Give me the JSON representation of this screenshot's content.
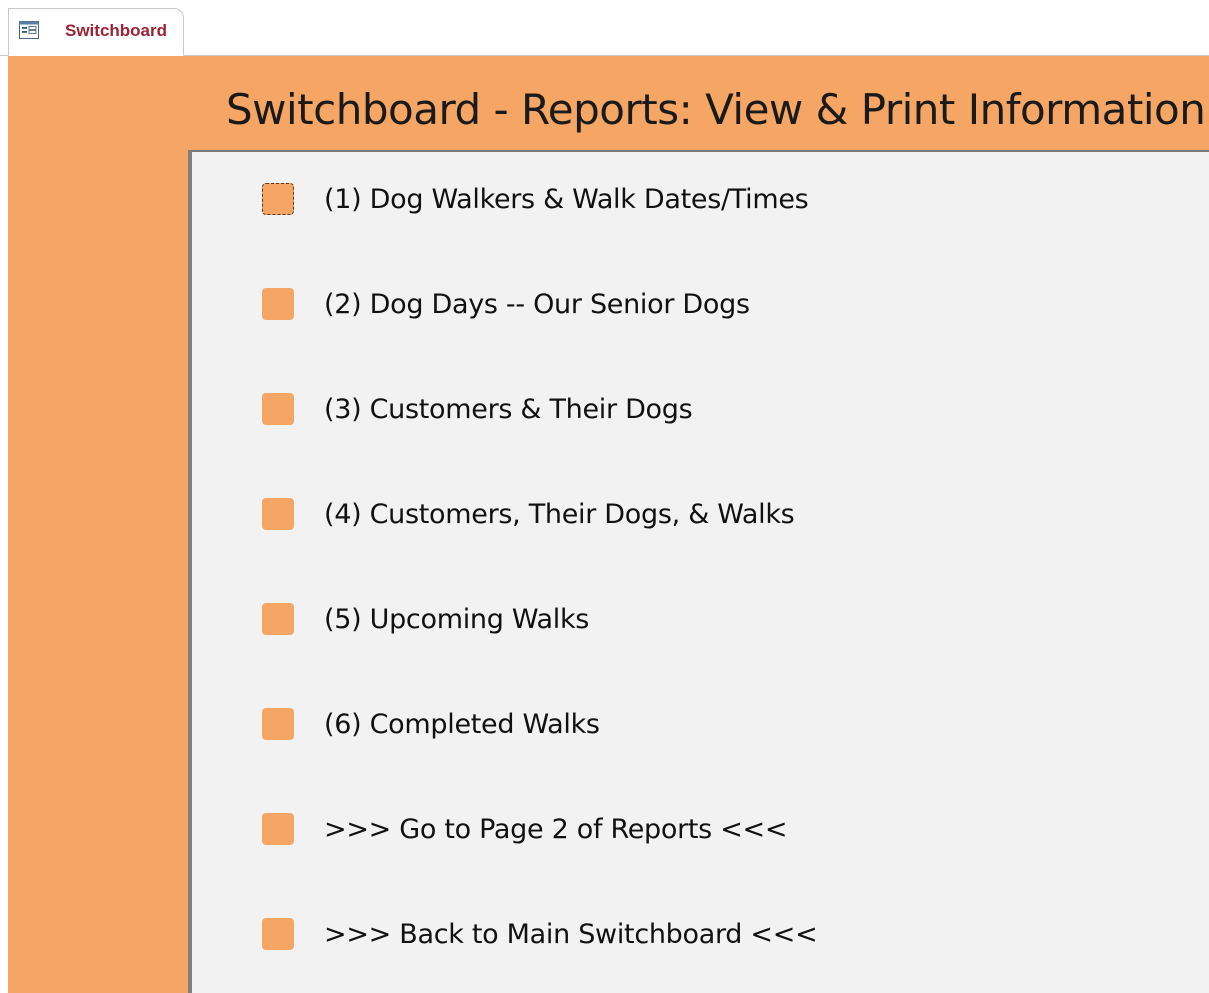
{
  "tab": {
    "label": "Switchboard",
    "icon": "form-icon"
  },
  "form": {
    "title": "Switchboard - Reports:  View & Print Information"
  },
  "menu": {
    "items": [
      {
        "label": "(1) Dog Walkers & Walk Dates/Times"
      },
      {
        "label": "(2) Dog Days -- Our Senior Dogs"
      },
      {
        "label": "(3) Customers & Their Dogs"
      },
      {
        "label": "(4) Customers, Their Dogs, & Walks"
      },
      {
        "label": "(5) Upcoming Walks"
      },
      {
        "label": "(6) Completed Walks"
      },
      {
        "label": ">>> Go to Page 2 of Reports <<<"
      },
      {
        "label": ">>> Back to Main Switchboard <<<"
      }
    ]
  },
  "colors": {
    "form_background": "#f6a664",
    "panel_background": "#f2f2f2",
    "tab_text": "#9b2335"
  }
}
